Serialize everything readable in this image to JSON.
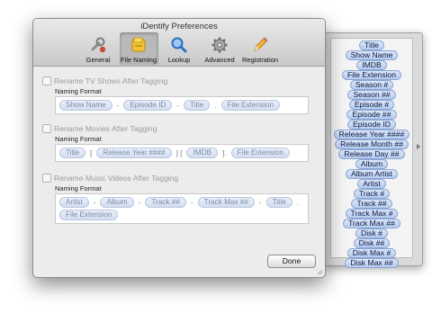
{
  "window": {
    "title": "iDentify Preferences"
  },
  "toolbar": {
    "tabs": [
      {
        "label": "General",
        "icon": "wrench-icon"
      },
      {
        "label": "File Naming",
        "icon": "folder-icon"
      },
      {
        "label": "Lookup",
        "icon": "magnifier-icon"
      },
      {
        "label": "Advanced",
        "icon": "gear-icon"
      },
      {
        "label": "Registration",
        "icon": "pencil-icon"
      }
    ],
    "active_tab": "File Naming"
  },
  "sections": [
    {
      "checkbox_label": "Rename TV Shows After Tagging",
      "checked": false,
      "format_caption": "Naming Format",
      "format": [
        {
          "kind": "token",
          "text": "Show Name"
        },
        {
          "kind": "sep",
          "text": "-"
        },
        {
          "kind": "token",
          "text": "Episode ID"
        },
        {
          "kind": "sep",
          "text": "-"
        },
        {
          "kind": "token",
          "text": "Title"
        },
        {
          "kind": "sep",
          "text": "."
        },
        {
          "kind": "token",
          "text": "File Extension"
        }
      ]
    },
    {
      "checkbox_label": "Rename Movies After Tagging",
      "checked": false,
      "format_caption": "Naming Format",
      "format": [
        {
          "kind": "token",
          "text": "Title"
        },
        {
          "kind": "sep",
          "text": "["
        },
        {
          "kind": "token",
          "text": "Release Year ####"
        },
        {
          "kind": "sep",
          "text": "] ["
        },
        {
          "kind": "token",
          "text": "IMDB"
        },
        {
          "kind": "sep",
          "text": "]."
        },
        {
          "kind": "token",
          "text": "File Extension"
        }
      ]
    },
    {
      "checkbox_label": "Rename Music Videos After Tagging",
      "checked": false,
      "format_caption": "Naming Format",
      "format": [
        {
          "kind": "token",
          "text": "Artist"
        },
        {
          "kind": "sep",
          "text": "-"
        },
        {
          "kind": "token",
          "text": "Album"
        },
        {
          "kind": "sep",
          "text": "-"
        },
        {
          "kind": "token",
          "text": "Track ##"
        },
        {
          "kind": "sep",
          "text": "-"
        },
        {
          "kind": "token",
          "text": "Track Max ##"
        },
        {
          "kind": "sep",
          "text": "-"
        },
        {
          "kind": "token",
          "text": "Title"
        },
        {
          "kind": "sep",
          "text": "."
        },
        {
          "kind": "token",
          "text": "File Extension"
        }
      ]
    }
  ],
  "buttons": {
    "done": "Done"
  },
  "palette": {
    "tokens": [
      "Title",
      "Show Name",
      "IMDB",
      "File Extension",
      "Season #",
      "Season ##",
      "Episode #",
      "Episode ##",
      "Episode ID",
      "Release Year ####",
      "Release Month ##",
      "Release Day ##",
      "Album",
      "Album Artist",
      "Artist",
      "Track #",
      "Track ##",
      "Track Max #",
      "Track Max ##",
      "Disk #",
      "Disk ##",
      "Disk Max #",
      "Disk Max ##"
    ]
  }
}
